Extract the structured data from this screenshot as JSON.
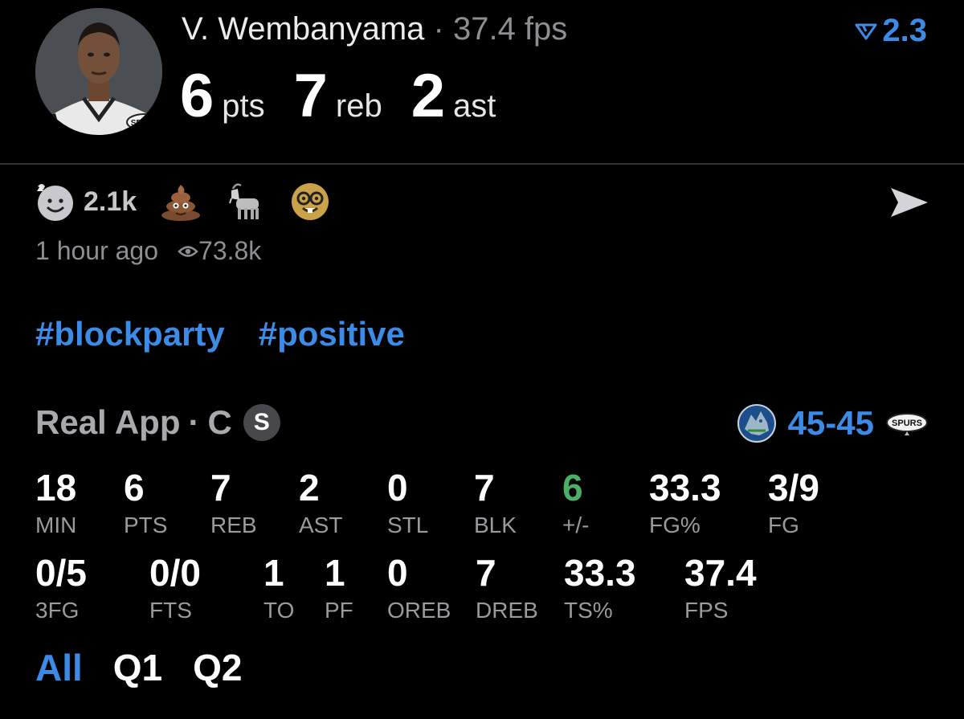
{
  "player": {
    "name": "V. Wembanyama",
    "separator": "·",
    "fps": "37.4 fps",
    "team_logo_text": "SPURS"
  },
  "vote": {
    "icon": "downvote-arrow-icon",
    "value": "2.3"
  },
  "statline": [
    {
      "value": "6",
      "unit": "pts"
    },
    {
      "value": "7",
      "unit": "reb"
    },
    {
      "value": "2",
      "unit": "ast"
    }
  ],
  "reactions": {
    "goat_smiley_count": "2.1k",
    "items": [
      "goat-smiley-icon",
      "poop-icon",
      "goat-icon",
      "nerd-face-icon"
    ],
    "share_icon": "send-icon"
  },
  "meta": {
    "time": "1 hour ago",
    "views": "73.8k"
  },
  "tags": [
    "#blockparty",
    "#positive"
  ],
  "game": {
    "app": "Real App",
    "separator": "·",
    "position": "C",
    "badge": "S",
    "score": "45-45",
    "home_logo_text": "SPURS"
  },
  "stats_row1": [
    {
      "value": "18",
      "label": "MIN"
    },
    {
      "value": "6",
      "label": "PTS"
    },
    {
      "value": "7",
      "label": "REB"
    },
    {
      "value": "2",
      "label": "AST"
    },
    {
      "value": "0",
      "label": "STL"
    },
    {
      "value": "7",
      "label": "BLK"
    },
    {
      "value": "6",
      "label": "+/-"
    },
    {
      "value": "33.3",
      "label": "FG%"
    },
    {
      "value": "3/9",
      "label": "FG"
    }
  ],
  "stats_row2": [
    {
      "value": "0/5",
      "label": "3FG"
    },
    {
      "value": "0/0",
      "label": "FTS"
    },
    {
      "value": "1",
      "label": "TO"
    },
    {
      "value": "1",
      "label": "PF"
    },
    {
      "value": "0",
      "label": "OREB"
    },
    {
      "value": "7",
      "label": "DREB"
    },
    {
      "value": "33.3",
      "label": "TS%"
    },
    {
      "value": "37.4",
      "label": "FPS"
    }
  ],
  "periods": [
    "All",
    "Q1",
    "Q2"
  ],
  "colors": {
    "accent": "#3c8ce7",
    "positive": "#4caf68",
    "muted": "#8e8e93"
  }
}
